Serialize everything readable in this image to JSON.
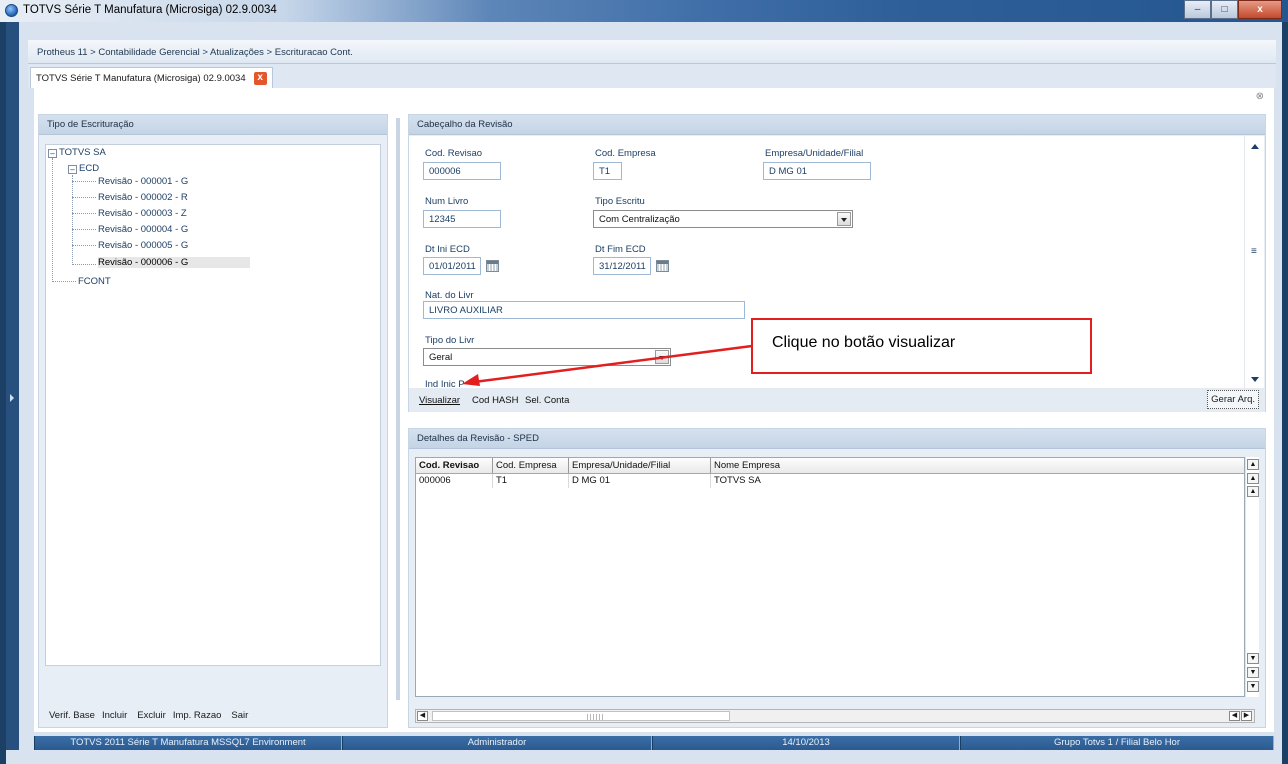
{
  "window": {
    "title": "TOTVS Série T Manufatura (Microsiga) 02.9.0034",
    "minimize": "–",
    "maximize": "□",
    "close": "x"
  },
  "breadcrumb": "Protheus 11 > Contabilidade Gerencial > Atualizações > Escrituracao Cont.",
  "tab": {
    "label": "TOTVS Série T Manufatura (Microsiga) 02.9.0034",
    "close": "x"
  },
  "tree_panel": {
    "title": "Tipo de Escrituração",
    "nodes": [
      {
        "label": "TOTVS SA"
      },
      {
        "label": "ECD"
      },
      {
        "label": "Revisão - 000001 - G"
      },
      {
        "label": "Revisão - 000002 - R"
      },
      {
        "label": "Revisão - 000003 - Z"
      },
      {
        "label": "Revisão - 000004 - G"
      },
      {
        "label": "Revisão - 000005 - G"
      },
      {
        "label": "Revisão - 000006 - G"
      },
      {
        "label": "FCONT"
      }
    ],
    "expander_minus": "–",
    "footer": [
      "Verif. Base",
      "Incluir",
      "Excluir",
      "Imp. Razao",
      "Sair"
    ]
  },
  "header_panel": {
    "title": "Cabeçalho da Revisão",
    "fields": {
      "cod_revisao": {
        "label": "Cod. Revisao",
        "value": "000006"
      },
      "cod_empresa": {
        "label": "Cod. Empresa",
        "value": "T1"
      },
      "empresa_filial": {
        "label": "Empresa/Unidade/Filial",
        "value": "D MG 01"
      },
      "num_livro": {
        "label": "Num Livro",
        "value": "12345"
      },
      "tipo_escritu": {
        "label": "Tipo Escritu",
        "value": "Com Centralização"
      },
      "dt_ini": {
        "label": "Dt Ini ECD",
        "value": "01/01/2011"
      },
      "dt_fim": {
        "label": "Dt Fim ECD",
        "value": "31/12/2011"
      },
      "nat_livro": {
        "label": "Nat. do Livr",
        "value": "LIVRO AUXILIAR"
      },
      "tipo_livro": {
        "label": "Tipo do Livr",
        "value": "Geral"
      },
      "ind_inic": {
        "label": "Ind Inic P"
      }
    },
    "actions": {
      "visualizar": "Visualizar",
      "cod_hash": "Cod HASH",
      "sel_conta": "Sel. Conta",
      "gerar": "Gerar Arq."
    }
  },
  "details_panel": {
    "title": "Detalhes da Revisão - SPED",
    "columns": [
      "Cod. Revisao",
      "Cod. Empresa",
      "Empresa/Unidade/Filial",
      "Nome Empresa"
    ],
    "rows": [
      [
        "000006",
        "T1",
        "D MG 01",
        "TOTVS SA"
      ]
    ]
  },
  "callout": "Clique no botão visualizar",
  "status_bar": [
    "TOTVS 2011 Série T Manufatura MSSQL7 Environment",
    "Administrador",
    "14/10/2013",
    "Grupo Totvs 1 / Filial Belo Hor"
  ],
  "colors": {
    "accent": "#1c3f66",
    "callout_border": "#e11f1f",
    "status_bar": "#2a5a90"
  }
}
